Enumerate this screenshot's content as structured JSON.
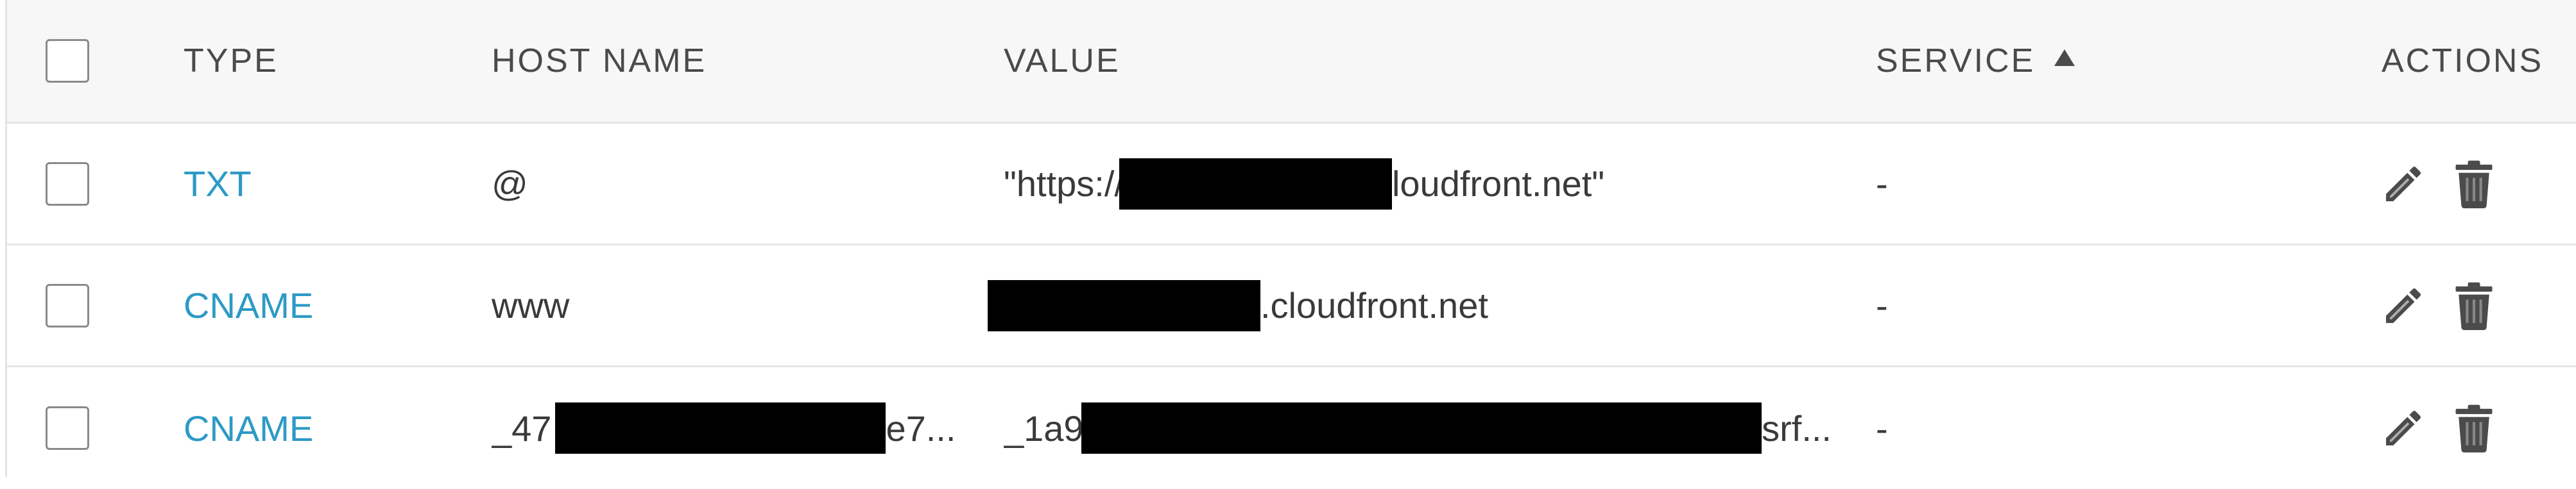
{
  "table": {
    "headers": {
      "type": "TYPE",
      "host_name": "HOST NAME",
      "value": "VALUE",
      "service": "SERVICE",
      "actions": "ACTIONS"
    },
    "sort": {
      "column": "service",
      "direction": "ascending"
    },
    "rows": [
      {
        "type": "TXT",
        "host_name": "@",
        "value_prefix": "\"https://",
        "value_suffix": "loudfront.net\"",
        "service": "-"
      },
      {
        "type": "CNAME",
        "host_name": "www",
        "value_prefix": "",
        "value_suffix": ".cloudfront.net",
        "service": "-"
      },
      {
        "type": "CNAME",
        "host_name_prefix": "_47",
        "host_name_suffix": "e7...",
        "value_prefix": "_1a9",
        "value_suffix": "srf...",
        "service": "-"
      }
    ]
  },
  "icons": {
    "sort": "sort-ascending-icon",
    "edit": "pencil-icon",
    "delete": "trash-icon"
  },
  "colors": {
    "link": "#2d9ac5",
    "header_bg": "#f7f7f7",
    "redaction": "#000000",
    "icon": "#4b4b4b"
  }
}
